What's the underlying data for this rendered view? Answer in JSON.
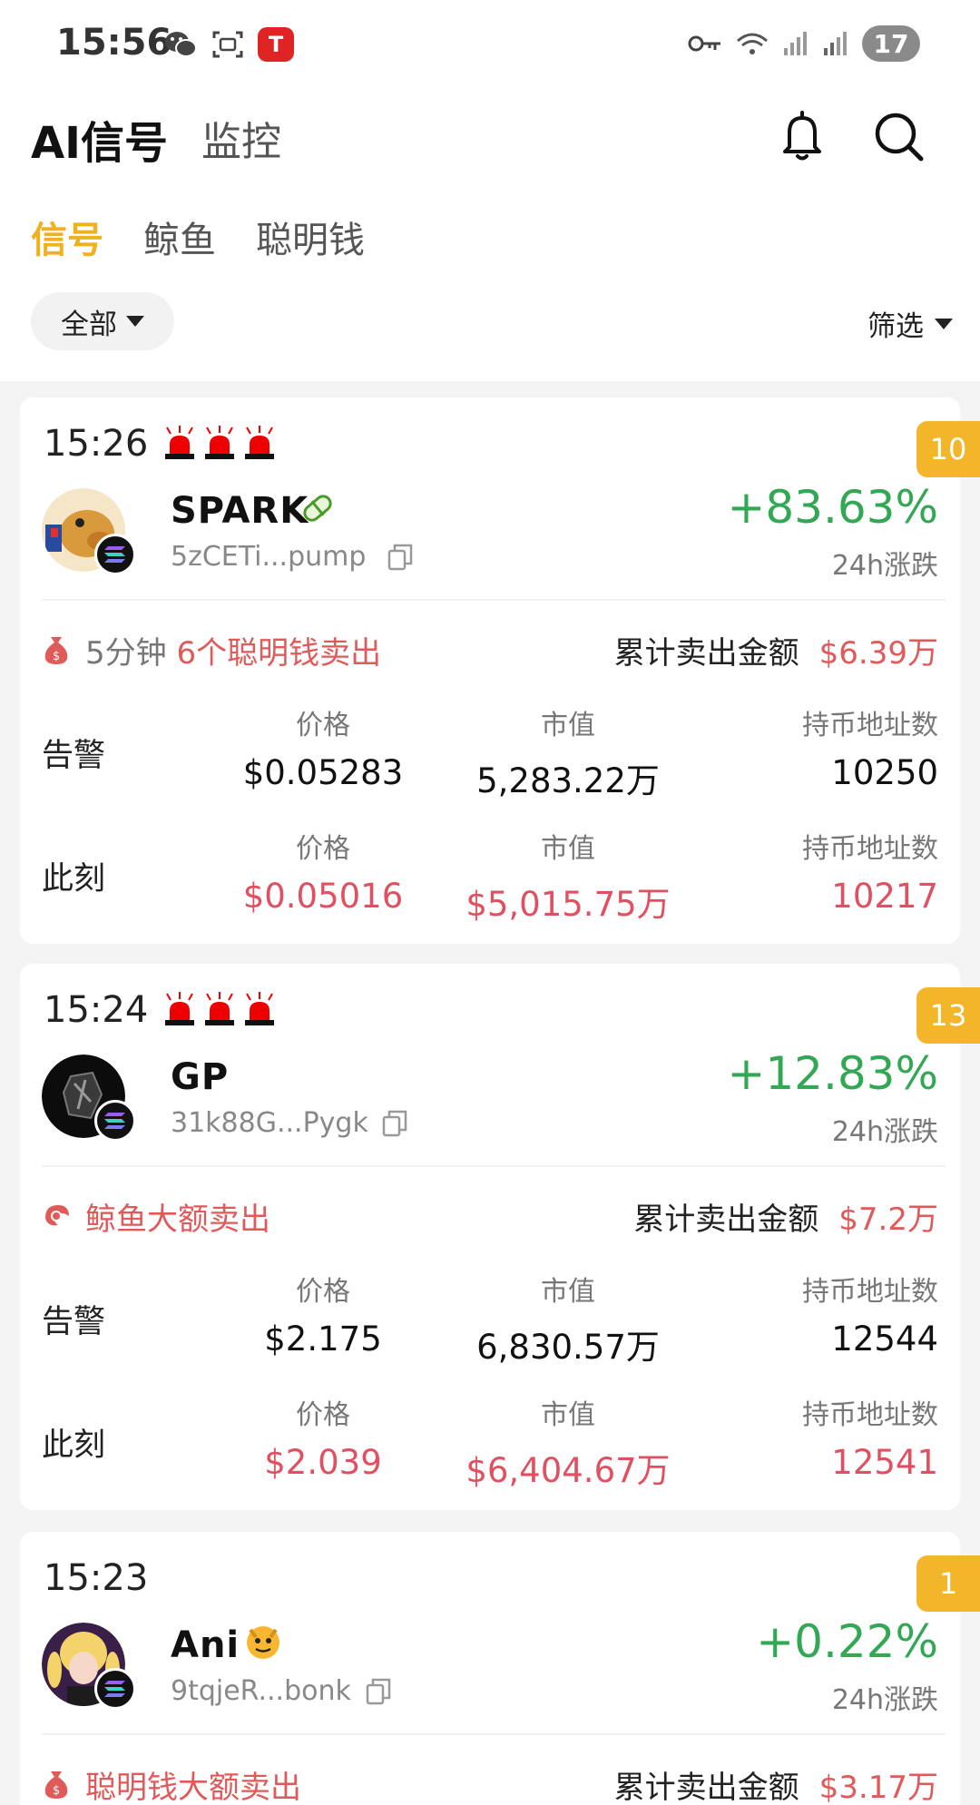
{
  "status_bar": {
    "time": "15:56",
    "battery": "17",
    "tesla": "T"
  },
  "header": {
    "title": "AI信号",
    "subtitle": "监控"
  },
  "tabs": [
    {
      "label": "信号",
      "active": true
    },
    {
      "label": "鲸鱼",
      "active": false
    },
    {
      "label": "聪明钱",
      "active": false
    }
  ],
  "filters": {
    "all": "全部",
    "sort": "筛选"
  },
  "labels": {
    "change": "24h涨跌",
    "alert": "告警",
    "now": "此刻",
    "price": "价格",
    "mcap": "市值",
    "holders": "持币地址数",
    "cum_sell": "累计卖出金额"
  },
  "cards": [
    {
      "time": "15:26",
      "rank": "10",
      "name": "SPARK",
      "address": "5zCETi...pump",
      "change": "+83.63%",
      "event_prefix": "5分钟",
      "event_text": "6个聪明钱卖出",
      "sell_amount": "$6.39万",
      "alert": {
        "price": "$0.05283",
        "mcap": "5,283.22万",
        "holders": "10250"
      },
      "now": {
        "price": "$0.05016",
        "mcap": "$5,015.75万",
        "holders": "10217"
      }
    },
    {
      "time": "15:24",
      "rank": "13",
      "name": "GP",
      "address": "31k88G...Pygk",
      "change": "+12.83%",
      "event_prefix": "",
      "event_text": "鲸鱼大额卖出",
      "sell_amount": "$7.2万",
      "alert": {
        "price": "$2.175",
        "mcap": "6,830.57万",
        "holders": "12544"
      },
      "now": {
        "price": "$2.039",
        "mcap": "$6,404.67万",
        "holders": "12541"
      }
    },
    {
      "time": "15:23",
      "rank": "1",
      "name": "Ani",
      "address": "9tqjeR...bonk",
      "change": "+0.22%",
      "event_prefix": "",
      "event_text": "聪明钱大额卖出",
      "sell_amount": "$3.17万"
    }
  ],
  "colors": {
    "accent": "#f0b020",
    "up": "#33a854",
    "down": "#e05060"
  }
}
